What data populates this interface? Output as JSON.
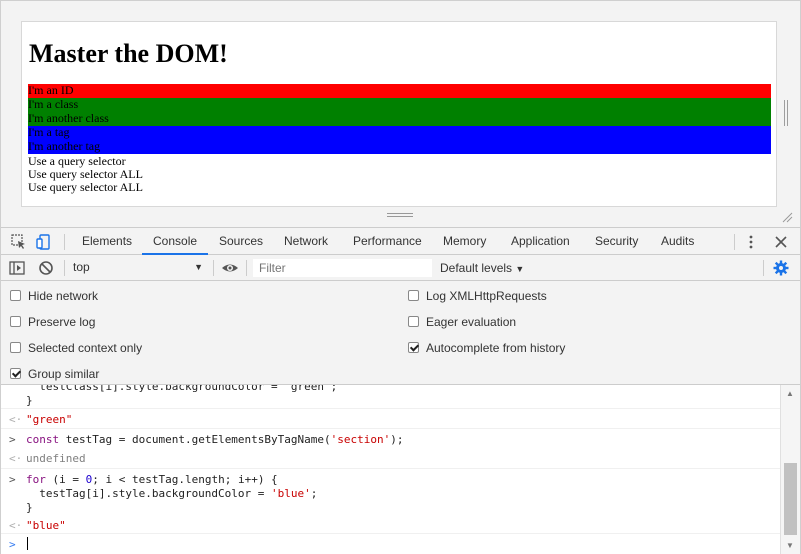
{
  "page": {
    "heading": "Master the DOM!",
    "sections": [
      {
        "text": "I'm an ID",
        "color": "#ff0000"
      },
      {
        "text": "I'm a class",
        "color": "#008000"
      },
      {
        "text": "I'm another class",
        "color": "#008000"
      },
      {
        "text": "I'm a tag",
        "color": "#0000ff"
      },
      {
        "text": "I'm another tag",
        "color": "#0000ff"
      }
    ],
    "plain_items": [
      "Use a query selector",
      "Use query selector ALL",
      "Use query selector ALL"
    ]
  },
  "devtools": {
    "tabs": [
      "Elements",
      "Console",
      "Sources",
      "Network",
      "Performance",
      "Memory",
      "Application",
      "Security",
      "Audits"
    ],
    "active_tab": "Console",
    "context": "top",
    "filter_placeholder": "Filter",
    "levels": "Default levels",
    "settings_left": [
      {
        "label": "Hide network",
        "checked": false
      },
      {
        "label": "Preserve log",
        "checked": false
      },
      {
        "label": "Selected context only",
        "checked": false
      },
      {
        "label": "Group similar",
        "checked": true
      }
    ],
    "settings_right": [
      {
        "label": "Log XMLHttpRequests",
        "checked": false
      },
      {
        "label": "Eager evaluation",
        "checked": false
      },
      {
        "label": "Autocomplete from history",
        "checked": true
      }
    ],
    "accent": "#1a73e8"
  },
  "console": {
    "line1": "  testClass[i].style.backgroundColor = 'green';",
    "line2": "}",
    "line3": "\"green\"",
    "line4_a": "const testTag = document.getElementsByTagName(",
    "line4_b": "'section'",
    "line4_c": ");",
    "line5": "undefined",
    "line6_a": "for",
    "line6_b": " (i = ",
    "line6_c": "0",
    "line6_d": "; i < testTag.length; i++) {",
    "line7_a": "  testTag[i].style.backgroundColor = ",
    "line7_b": "'blue'",
    "line7_c": ";",
    "line8": "}",
    "line9": "\"blue\""
  }
}
